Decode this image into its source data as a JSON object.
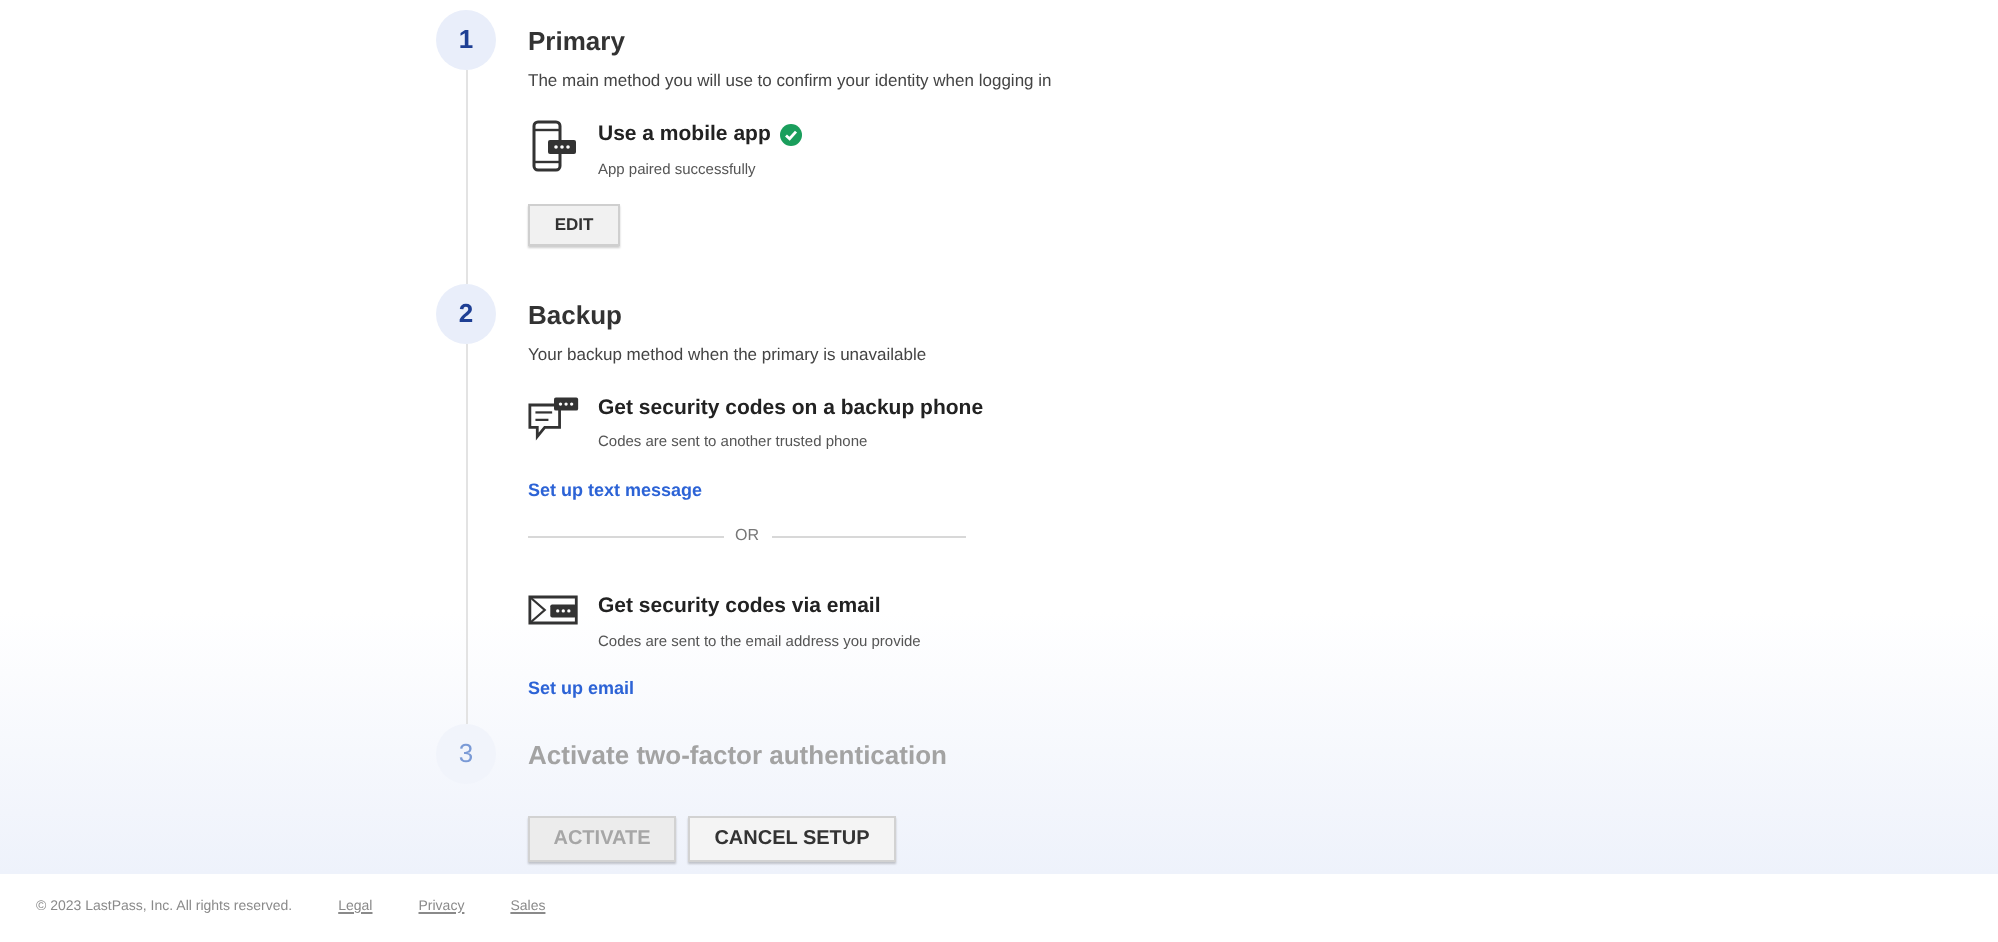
{
  "steps": [
    {
      "number": "1",
      "title": "Primary",
      "description": "The main method you will use to confirm your identity when logging in",
      "disabled": false,
      "methods": [
        {
          "kind": "app",
          "title": "Use a mobile app",
          "verified": true,
          "note": "App paired successfully",
          "action": {
            "kind": "button",
            "label": "EDIT"
          }
        }
      ]
    },
    {
      "number": "2",
      "title": "Backup",
      "description": "Your backup method when the primary is unavailable",
      "disabled": false,
      "methods": [
        {
          "kind": "sms",
          "title": "Get security codes on a backup phone",
          "verified": false,
          "note": "Codes are sent to another trusted phone",
          "action": {
            "kind": "link",
            "label": "Set up text message"
          }
        },
        {
          "kind": "separator",
          "label": "OR"
        },
        {
          "kind": "email",
          "title": "Get security codes via email",
          "verified": false,
          "note": "Codes are sent to the email address you provide",
          "action": {
            "kind": "link",
            "label": "Set up email"
          }
        }
      ]
    },
    {
      "number": "3",
      "title": "Activate two-factor authentication",
      "disabled": true
    }
  ],
  "buttons": [
    {
      "label": "ACTIVATE",
      "disabled": true
    },
    {
      "label": "CANCEL SETUP",
      "disabled": false
    }
  ],
  "footer": {
    "copyright": "© 2023 LastPass, Inc. All rights reserved.",
    "links": [
      "Legal",
      "Privacy",
      "Sales"
    ]
  }
}
